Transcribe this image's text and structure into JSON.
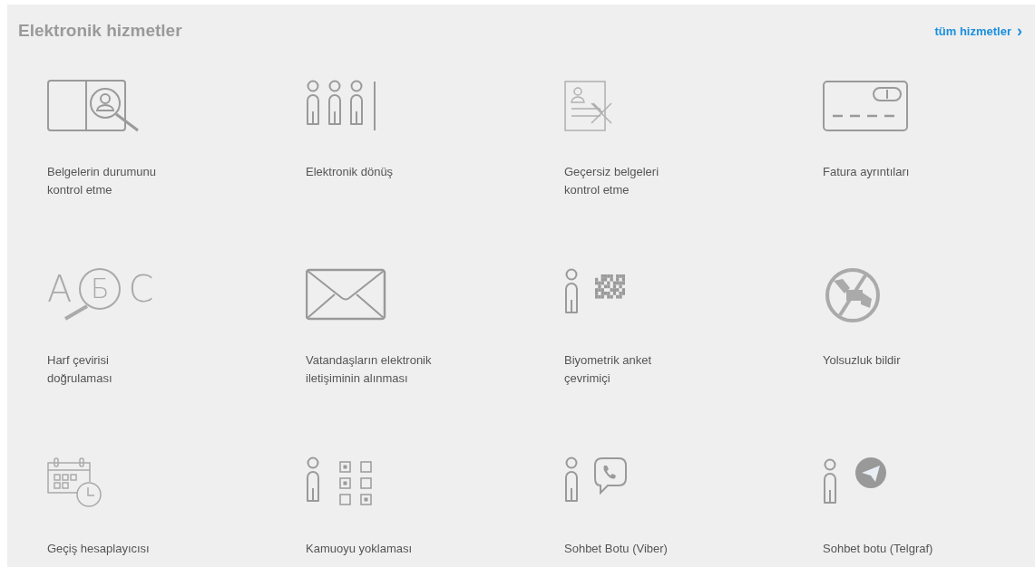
{
  "section": {
    "title": "Elektronik hizmetler",
    "all_link": "tüm hizmetler",
    "all_link_arrow": "›"
  },
  "services": [
    {
      "kind": "doc-search",
      "label": "Belgelerin durumunu\nkontrol etme"
    },
    {
      "kind": "queue",
      "label": "Elektronik dönüş"
    },
    {
      "kind": "invalid-doc",
      "label": "Geçersiz belgeleri\nkontrol etme"
    },
    {
      "kind": "card",
      "label": "Fatura ayrıntıları"
    },
    {
      "kind": "letters",
      "label": "Harf çevirisi\ndoğrulaması",
      "glyphs": [
        "A",
        "Б",
        "C"
      ]
    },
    {
      "kind": "envelope",
      "label": "Vatandaşların elektronik\niletişiminin alınması"
    },
    {
      "kind": "person-qr",
      "label": "Biyometrik anket\nçevrimiçi"
    },
    {
      "kind": "no-bribe",
      "label": "Yolsuzluk bildir"
    },
    {
      "kind": "calendar",
      "label": "Geçiş hesaplayıcısı"
    },
    {
      "kind": "poll",
      "label": "Kamuoyu yoklaması"
    },
    {
      "kind": "person-chat",
      "label": "Sohbet Botu (Viber)"
    },
    {
      "kind": "person-plane",
      "label": "Sohbet botu (Telgraf)"
    }
  ]
}
